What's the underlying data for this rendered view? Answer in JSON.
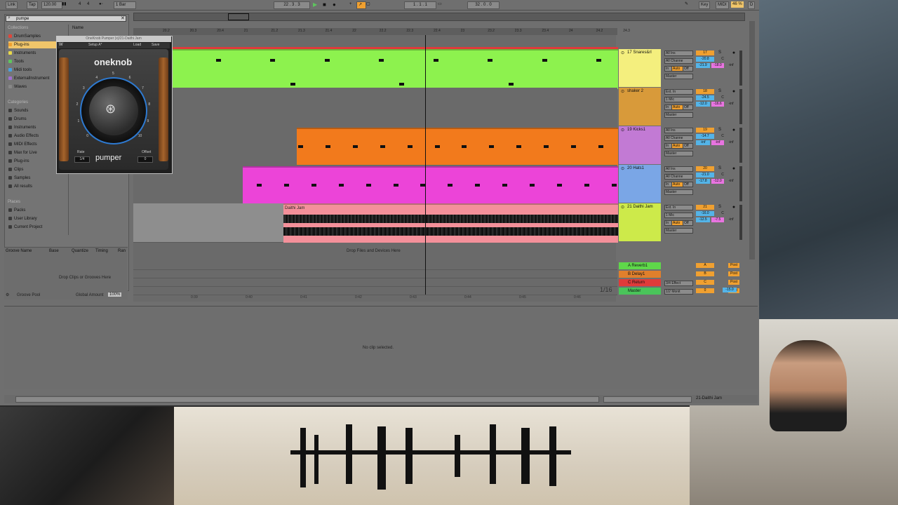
{
  "ctrl": {
    "link": "Link",
    "tap": "Tap",
    "tempo": "120.00",
    "sig_num": "4",
    "sig_den": "4",
    "quant": "1 Bar",
    "pos": "22 . 3 . 3",
    "loop_start": "1 . 1 . 1",
    "loop_len": "32 . 0 . 0",
    "key": "Key",
    "midi": "MIDI",
    "cpu": "46 %",
    "d": "D"
  },
  "browser": {
    "search": "pumpe",
    "name_header": "Name",
    "collections_h": "Collections",
    "collections": [
      "DrumSamples",
      "Plug-ins",
      "Instruments",
      "Tools",
      "Midi tools",
      "ExternalInstrument",
      "Waves"
    ],
    "collection_colors": [
      "#e0453a",
      "#f0a030",
      "#e8d84a",
      "#5ec45e",
      "#4aa0e0",
      "#a070d0",
      "#888888"
    ],
    "categories_h": "Categories",
    "categories": [
      "Sounds",
      "Drums",
      "Instruments",
      "Audio Effects",
      "MIDI Effects",
      "Max for Live",
      "Plug-ins",
      "Clips",
      "Samples",
      "All results"
    ],
    "places_h": "Places",
    "places": [
      "Packs",
      "User Library",
      "Current Project"
    ]
  },
  "groove": {
    "cols": [
      "Groove Name",
      "Base",
      "Quantize",
      "Timing",
      "Ran"
    ],
    "drop": "Drop Clips or Grooves Here",
    "pool": "Groove Pool",
    "global": "Global Amount",
    "global_val": "100%"
  },
  "plugin": {
    "title": "OneKnob Pumper (x)/21-Daithi Jam",
    "setup": "Setup A*",
    "load": "Load",
    "save": "Save",
    "brand": "oneknob",
    "name": "pumper",
    "rate": "Rate",
    "offset": "Offset",
    "rate_val": "1/4",
    "offset_val": "0",
    "scale": [
      "0",
      "1",
      "2",
      "3",
      "4",
      "5",
      "6",
      "7",
      "8",
      "9",
      "10"
    ]
  },
  "ruler": [
    "20.2",
    "20.3",
    "20.4",
    "21",
    "21.2",
    "21.3",
    "21.4",
    "22",
    "22.2",
    "22.3",
    "22.4",
    "23",
    "23.2",
    "23.3",
    "23.4",
    "24",
    "24.2",
    "24.3"
  ],
  "time_ruler": [
    "0:39",
    "0:40",
    "0:41",
    "0:42",
    "0:43",
    "0:44",
    "0:45",
    "0:46"
  ],
  "tracks": [
    {
      "name": "17 Snares&rl",
      "color": "#f4ef7e",
      "input": "All Ins",
      "channel": "All Channe",
      "num": "17",
      "vol": "-20.8",
      "pan": "C",
      "s1": "-21.9",
      "s2": "-18.0",
      "s3": "-inf",
      "mon": "In",
      "auto": "Auto",
      "off": "Off",
      "out": "Master"
    },
    {
      "name": "shaker 2",
      "color": "#d89a3a",
      "input": "Ext. In",
      "channel": "1 Mic",
      "num": "18",
      "vol": "-24.5",
      "pan": "C",
      "s1": "-12.0",
      "s2": "-16.6",
      "s3": "-inf",
      "mon": "In",
      "auto": "Auto",
      "off": "Off",
      "out": "Master"
    },
    {
      "name": "19 Kicks1",
      "color": "#c27ad4",
      "input": "All Ins",
      "channel": "All Channe",
      "num": "19",
      "vol": "-14.7",
      "pan": "C",
      "s1": "-inf",
      "s2": "-inf",
      "s3": "-inf",
      "mon": "In",
      "auto": "Auto",
      "off": "Off",
      "out": "Master"
    },
    {
      "name": "20 Hats1",
      "color": "#7aa6e6",
      "input": "All Ins",
      "channel": "All Channe",
      "num": "20",
      "vol": "-21.0",
      "pan": "C",
      "s1": "-17.8",
      "s2": "-12.0",
      "s3": "-inf",
      "mon": "In",
      "auto": "Auto",
      "off": "Off",
      "out": "Master"
    },
    {
      "name": "21 Daithi Jam",
      "color": "#cdea4a",
      "input": "Ext. In",
      "channel": "1 Mic",
      "num": "21",
      "vol": "-16.0",
      "pan": "C",
      "s1": "-12.5",
      "s2": "-7.5",
      "s3": "-inf",
      "mon": "In",
      "auto": "Auto",
      "off": "Off",
      "out": "Master"
    }
  ],
  "audio_clip": "Daithi Jam",
  "drop_devices": "Drop Files and Devices Here",
  "grid_label": "1/16",
  "returns": [
    {
      "name": "A Reverb1",
      "color": "#5fd84a",
      "route": "",
      "btn": "A",
      "post": "Post"
    },
    {
      "name": "B Delay1",
      "color": "#e07f2c",
      "route": "",
      "btn": "B",
      "post": "Post"
    },
    {
      "name": "C Return",
      "color": "#e03a3a",
      "route": "3/4 Effect",
      "btn": "C",
      "post": "Post"
    },
    {
      "name": "Master",
      "color": "#4ac45a",
      "route": "1/2 Monit",
      "btn": "0",
      "post": "Post"
    }
  ],
  "master_vol": "-15.0",
  "detail_msg": "No clip selected.",
  "status_track": "21-Daithi Jam"
}
